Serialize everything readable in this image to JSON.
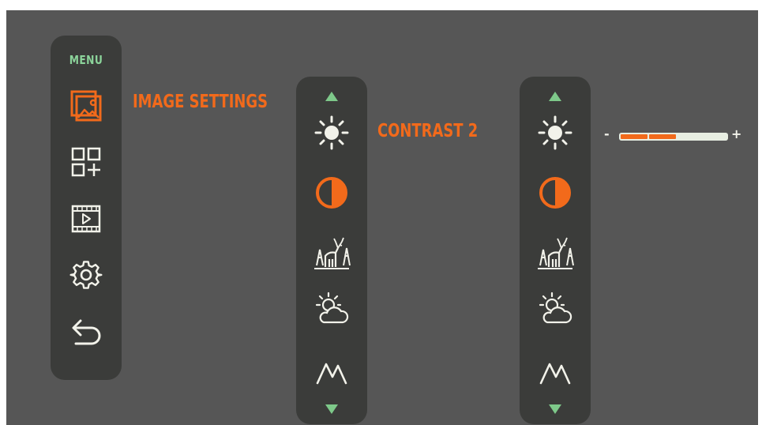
{
  "menu": {
    "title": "MENU",
    "items": [
      {
        "icon": "image-icon",
        "selected": true
      },
      {
        "icon": "add-widget-icon",
        "selected": false
      },
      {
        "icon": "video-icon",
        "selected": false
      },
      {
        "icon": "gear-icon",
        "selected": false
      },
      {
        "icon": "back-arrow-icon",
        "selected": false
      }
    ]
  },
  "image_settings": {
    "heading": "IMAGE SETTINGS",
    "items": [
      "brightness-icon",
      "contrast-icon",
      "scene-mode-icon",
      "weather-mode-icon",
      "sharpness-icon"
    ],
    "selected": "contrast-icon"
  },
  "contrast": {
    "heading": "CONTRAST 2",
    "minus_label": "-",
    "plus_label": "+",
    "level_segments": 2
  },
  "colors": {
    "accent": "#f26a1b",
    "menu_title": "#8bd39a",
    "icon": "#f2f2ea",
    "arrow": "#7ec98a",
    "panel": "#3b3c3a",
    "background": "#565656"
  }
}
